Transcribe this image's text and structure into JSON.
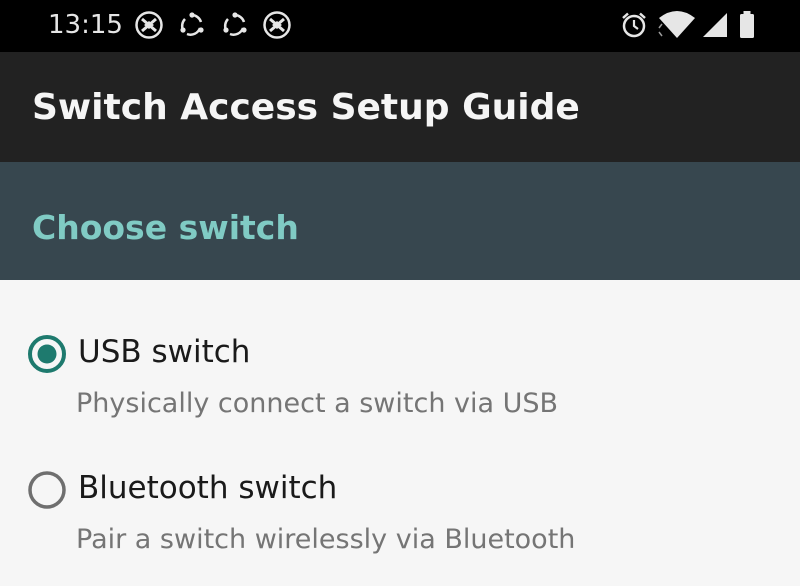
{
  "status_bar": {
    "time": "13:15",
    "left_icons": [
      "shield-logo-icon",
      "sync-cycle-icon",
      "sync-cycle-icon",
      "shield-logo-icon"
    ],
    "right_icons": [
      "alarm-icon",
      "wifi-icon",
      "cellular-signal-icon",
      "battery-icon"
    ]
  },
  "app_bar": {
    "title": "Switch Access Setup Guide"
  },
  "section": {
    "title": "Choose switch"
  },
  "options": [
    {
      "label": "USB switch",
      "description": "Physically connect a switch via USB",
      "selected": true
    },
    {
      "label": "Bluetooth switch",
      "description": "Pair a switch wirelessly via Bluetooth",
      "selected": false
    }
  ],
  "colors": {
    "status_bar_bg": "#000000",
    "app_bar_bg": "#222222",
    "section_bg": "#37474f",
    "section_text": "#80cbc4",
    "accent": "#1e7a6e",
    "content_bg": "#f6f6f6"
  }
}
